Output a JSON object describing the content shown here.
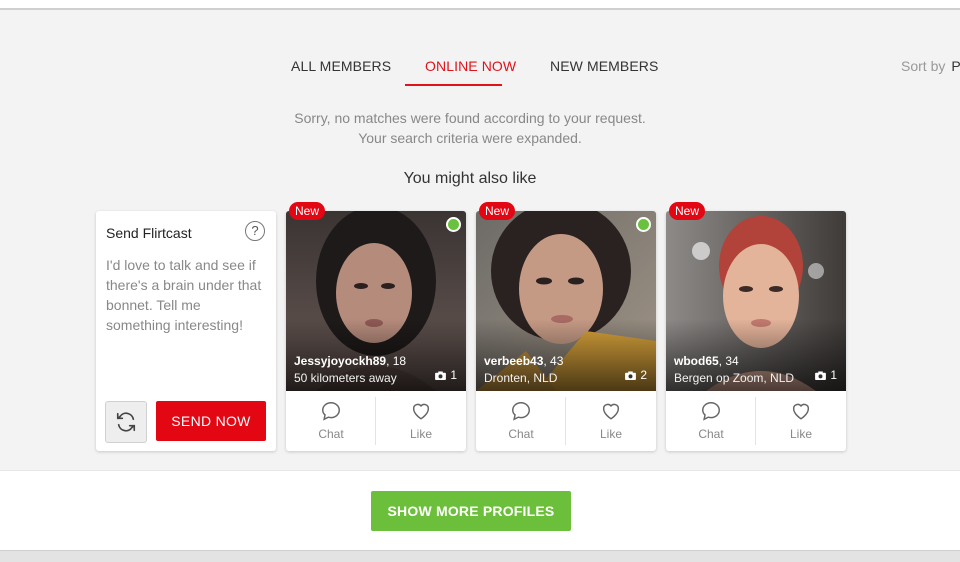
{
  "tabs": [
    {
      "label": "ALL MEMBERS",
      "active": false
    },
    {
      "label": "ONLINE NOW",
      "active": true
    },
    {
      "label": "NEW MEMBERS",
      "active": false
    }
  ],
  "sort": {
    "label": "Sort by",
    "value": "P"
  },
  "message": {
    "line1": "Sorry, no matches were found according to your request.",
    "line2": "Your search criteria were expanded."
  },
  "suggest_heading": "You might also like",
  "flirtcast": {
    "title": "Send Flirtcast",
    "help": "?",
    "text": "I'd love to talk and see if there's a brain under that bonnet. Tell me something interesting!",
    "refresh_icon": "refresh-icon",
    "send_label": "SEND NOW"
  },
  "profiles": [
    {
      "badge": "New",
      "online": true,
      "name": "Jessyjoyockh89",
      "age": ", 18",
      "location": "50 kilometers away",
      "photos": "1",
      "chat_label": "Chat",
      "like_label": "Like"
    },
    {
      "badge": "New",
      "online": true,
      "name": "verbeeb43",
      "age": ", 43",
      "location": "Dronten, NLD",
      "photos": "2",
      "chat_label": "Chat",
      "like_label": "Like"
    },
    {
      "badge": "New",
      "online": false,
      "name": "wbod65",
      "age": ", 34",
      "location": "Bergen op Zoom, NLD",
      "photos": "1",
      "chat_label": "Chat",
      "like_label": "Like"
    }
  ],
  "show_more_label": "SHOW MORE PROFILES",
  "colors": {
    "accent_red": "#e30613",
    "online_green": "#6ac13e",
    "cta_green": "#6cbf3b"
  }
}
